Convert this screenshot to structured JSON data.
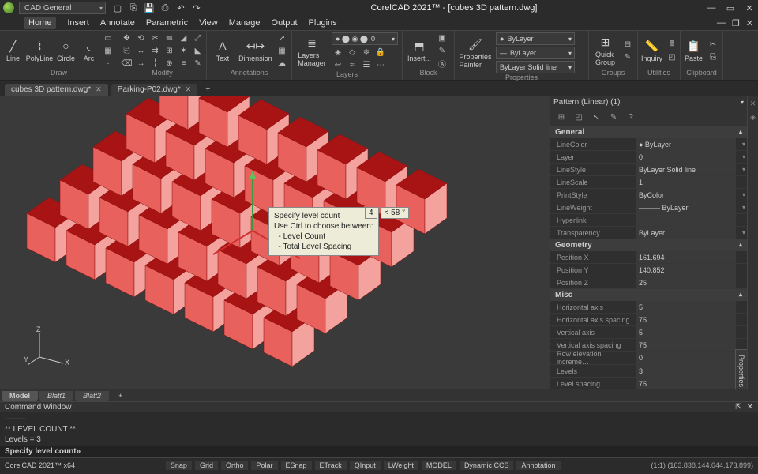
{
  "titlebar": {
    "workspace": "CAD General",
    "title": "CorelCAD 2021™ - [cubes 3D pattern.dwg]"
  },
  "menu": {
    "items": [
      "Home",
      "Insert",
      "Annotate",
      "Parametric",
      "View",
      "Manage",
      "Output",
      "Plugins"
    ],
    "active": 0
  },
  "ribbon": {
    "groups": {
      "draw": {
        "label": "Draw",
        "line": "Line",
        "polyline": "PolyLine",
        "circle": "Circle",
        "arc": "Arc"
      },
      "modify": {
        "label": "Modify"
      },
      "annotations": {
        "label": "Annotations",
        "text": "Text",
        "dimension": "Dimension"
      },
      "layers": {
        "label": "Layers",
        "manager": "Layers\nManager",
        "state": "0"
      },
      "block": {
        "label": "Block",
        "insert": "Insert..."
      },
      "properties": {
        "label": "Properties",
        "painter": "Properties\nPainter",
        "bylayer": "ByLayer",
        "linestyle": "ByLayer   Solid line"
      },
      "groups2": {
        "label": "Groups",
        "quick": "Quick\nGroup"
      },
      "utilities": {
        "label": "Utilities",
        "inquiry": "Inquiry"
      },
      "clipboard": {
        "label": "Clipboard",
        "paste": "Paste"
      }
    }
  },
  "doctabs": {
    "tabs": [
      {
        "name": "cubes 3D pattern.dwg*",
        "active": true
      },
      {
        "name": "Parking-P02.dwg*",
        "active": false
      }
    ]
  },
  "viewport": {
    "tooltip": {
      "l1": "Specify level count",
      "l2": "Use Ctrl to choose between:",
      "l3": "  - Level Count",
      "l4": "  - Total Level Spacing"
    },
    "inline": {
      "v1": "4",
      "v2": "< 58 °"
    }
  },
  "properties_panel": {
    "header": "Pattern (Linear) (1)",
    "vtab": "Properties",
    "general": {
      "title": "General",
      "rows": {
        "linecolor": {
          "k": "LineColor",
          "v": "● ByLayer"
        },
        "layer": {
          "k": "Layer",
          "v": "0"
        },
        "linestyle": {
          "k": "LineStyle",
          "v": "ByLayer   Solid line"
        },
        "linescale": {
          "k": "LineScale",
          "v": "1"
        },
        "printstyle": {
          "k": "PrintStyle",
          "v": "ByColor"
        },
        "lineweight": {
          "k": "LineWeight",
          "v": "——— ByLayer"
        },
        "hyperlink": {
          "k": "Hyperlink",
          "v": ""
        },
        "transparency": {
          "k": "Transparency",
          "v": "ByLayer"
        }
      }
    },
    "geometry": {
      "title": "Geometry",
      "rows": {
        "px": {
          "k": "Position X",
          "v": "161.694"
        },
        "py": {
          "k": "Position Y",
          "v": "140.852"
        },
        "pz": {
          "k": "Position Z",
          "v": "25"
        }
      }
    },
    "misc": {
      "title": "Misc",
      "rows": {
        "haxis": {
          "k": "Horizontal axis",
          "v": "5"
        },
        "hspacing": {
          "k": "Horizontal axis spacing",
          "v": "75"
        },
        "vaxis": {
          "k": "Vertical axis",
          "v": "5"
        },
        "vspacing": {
          "k": "Vertical axis spacing",
          "v": "75"
        },
        "rowelev": {
          "k": "Row elevation increme…",
          "v": "0"
        },
        "levels": {
          "k": "Levels",
          "v": "3"
        },
        "lspacing": {
          "k": "Level spacing",
          "v": "75"
        }
      }
    }
  },
  "modeltabs": {
    "tabs": [
      "Model",
      "Blatt1",
      "Blatt2"
    ],
    "active": 0
  },
  "cmdwin": {
    "title": "Command Window",
    "history": {
      "l1": "** LEVEL COUNT **",
      "l2": "Levels = 3"
    },
    "prompt": "Specify level count»"
  },
  "statusbar": {
    "app": "CorelCAD 2021™ x64",
    "buttons": [
      "Snap",
      "Grid",
      "Ortho",
      "Polar",
      "ESnap",
      "ETrack",
      "QInput",
      "LWeight",
      "MODEL",
      "Dynamic CCS",
      "Annotation"
    ],
    "coords": "(1:1)  (163.838,144.044,173.899)"
  }
}
